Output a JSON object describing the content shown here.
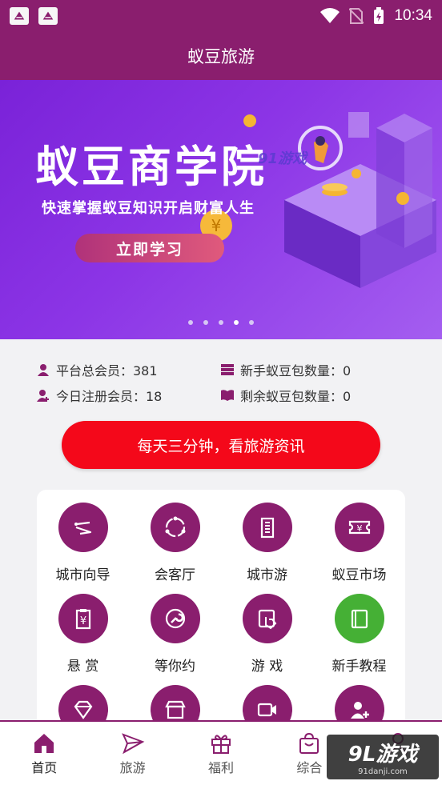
{
  "status_bar": {
    "time": "10:34"
  },
  "app_bar": {
    "title": "蚁豆旅游"
  },
  "banner": {
    "title": "蚁豆商学院",
    "subtitle": "快速掌握蚁豆知识开启财富人生",
    "cta_label": "立即学习",
    "overlay_text": "91游戏",
    "slide_count": 5,
    "active_slide": 4
  },
  "stats": {
    "total_members": "平台总会员：381",
    "new_pack_count": "新手蚁豆包数量：0",
    "today_registered": "今日注册会员：18",
    "remaining_pack_count": "剩余蚁豆包数量：0"
  },
  "news_button": {
    "label": "每天三分钟，看旅游资讯"
  },
  "grid": {
    "items": [
      {
        "label": "城市向导",
        "icon": "route-icon"
      },
      {
        "label": "会客厅",
        "icon": "circle-dots-icon"
      },
      {
        "label": "城市游",
        "icon": "building-icon"
      },
      {
        "label": "蚁豆市场",
        "icon": "ticket-yen-icon"
      },
      {
        "label": "悬 赏",
        "icon": "clipboard-yen-icon"
      },
      {
        "label": "等你约",
        "icon": "wrench-icon"
      },
      {
        "label": "游 戏",
        "icon": "touch-screen-icon"
      },
      {
        "label": "新手教程",
        "icon": "book-icon"
      },
      {
        "label": "",
        "icon": "gem-icon"
      },
      {
        "label": "",
        "icon": "shop-icon"
      },
      {
        "label": "",
        "icon": "video-camera-icon"
      },
      {
        "label": "",
        "icon": "add-user-icon"
      }
    ]
  },
  "bottom_nav": {
    "items": [
      {
        "label": "首页",
        "icon": "home-icon"
      },
      {
        "label": "旅游",
        "icon": "paper-plane-icon"
      },
      {
        "label": "福利",
        "icon": "gift-icon"
      },
      {
        "label": "综合",
        "icon": "bag-icon"
      },
      {
        "label": "",
        "icon": "user-icon"
      }
    ]
  },
  "watermark": {
    "logo": "9L游戏",
    "url": "91danji.com"
  },
  "colors": {
    "primary": "#8a1e6e",
    "accent_red": "#f4081a",
    "banner_purple": "#8c35e6",
    "green": "#45b035"
  }
}
